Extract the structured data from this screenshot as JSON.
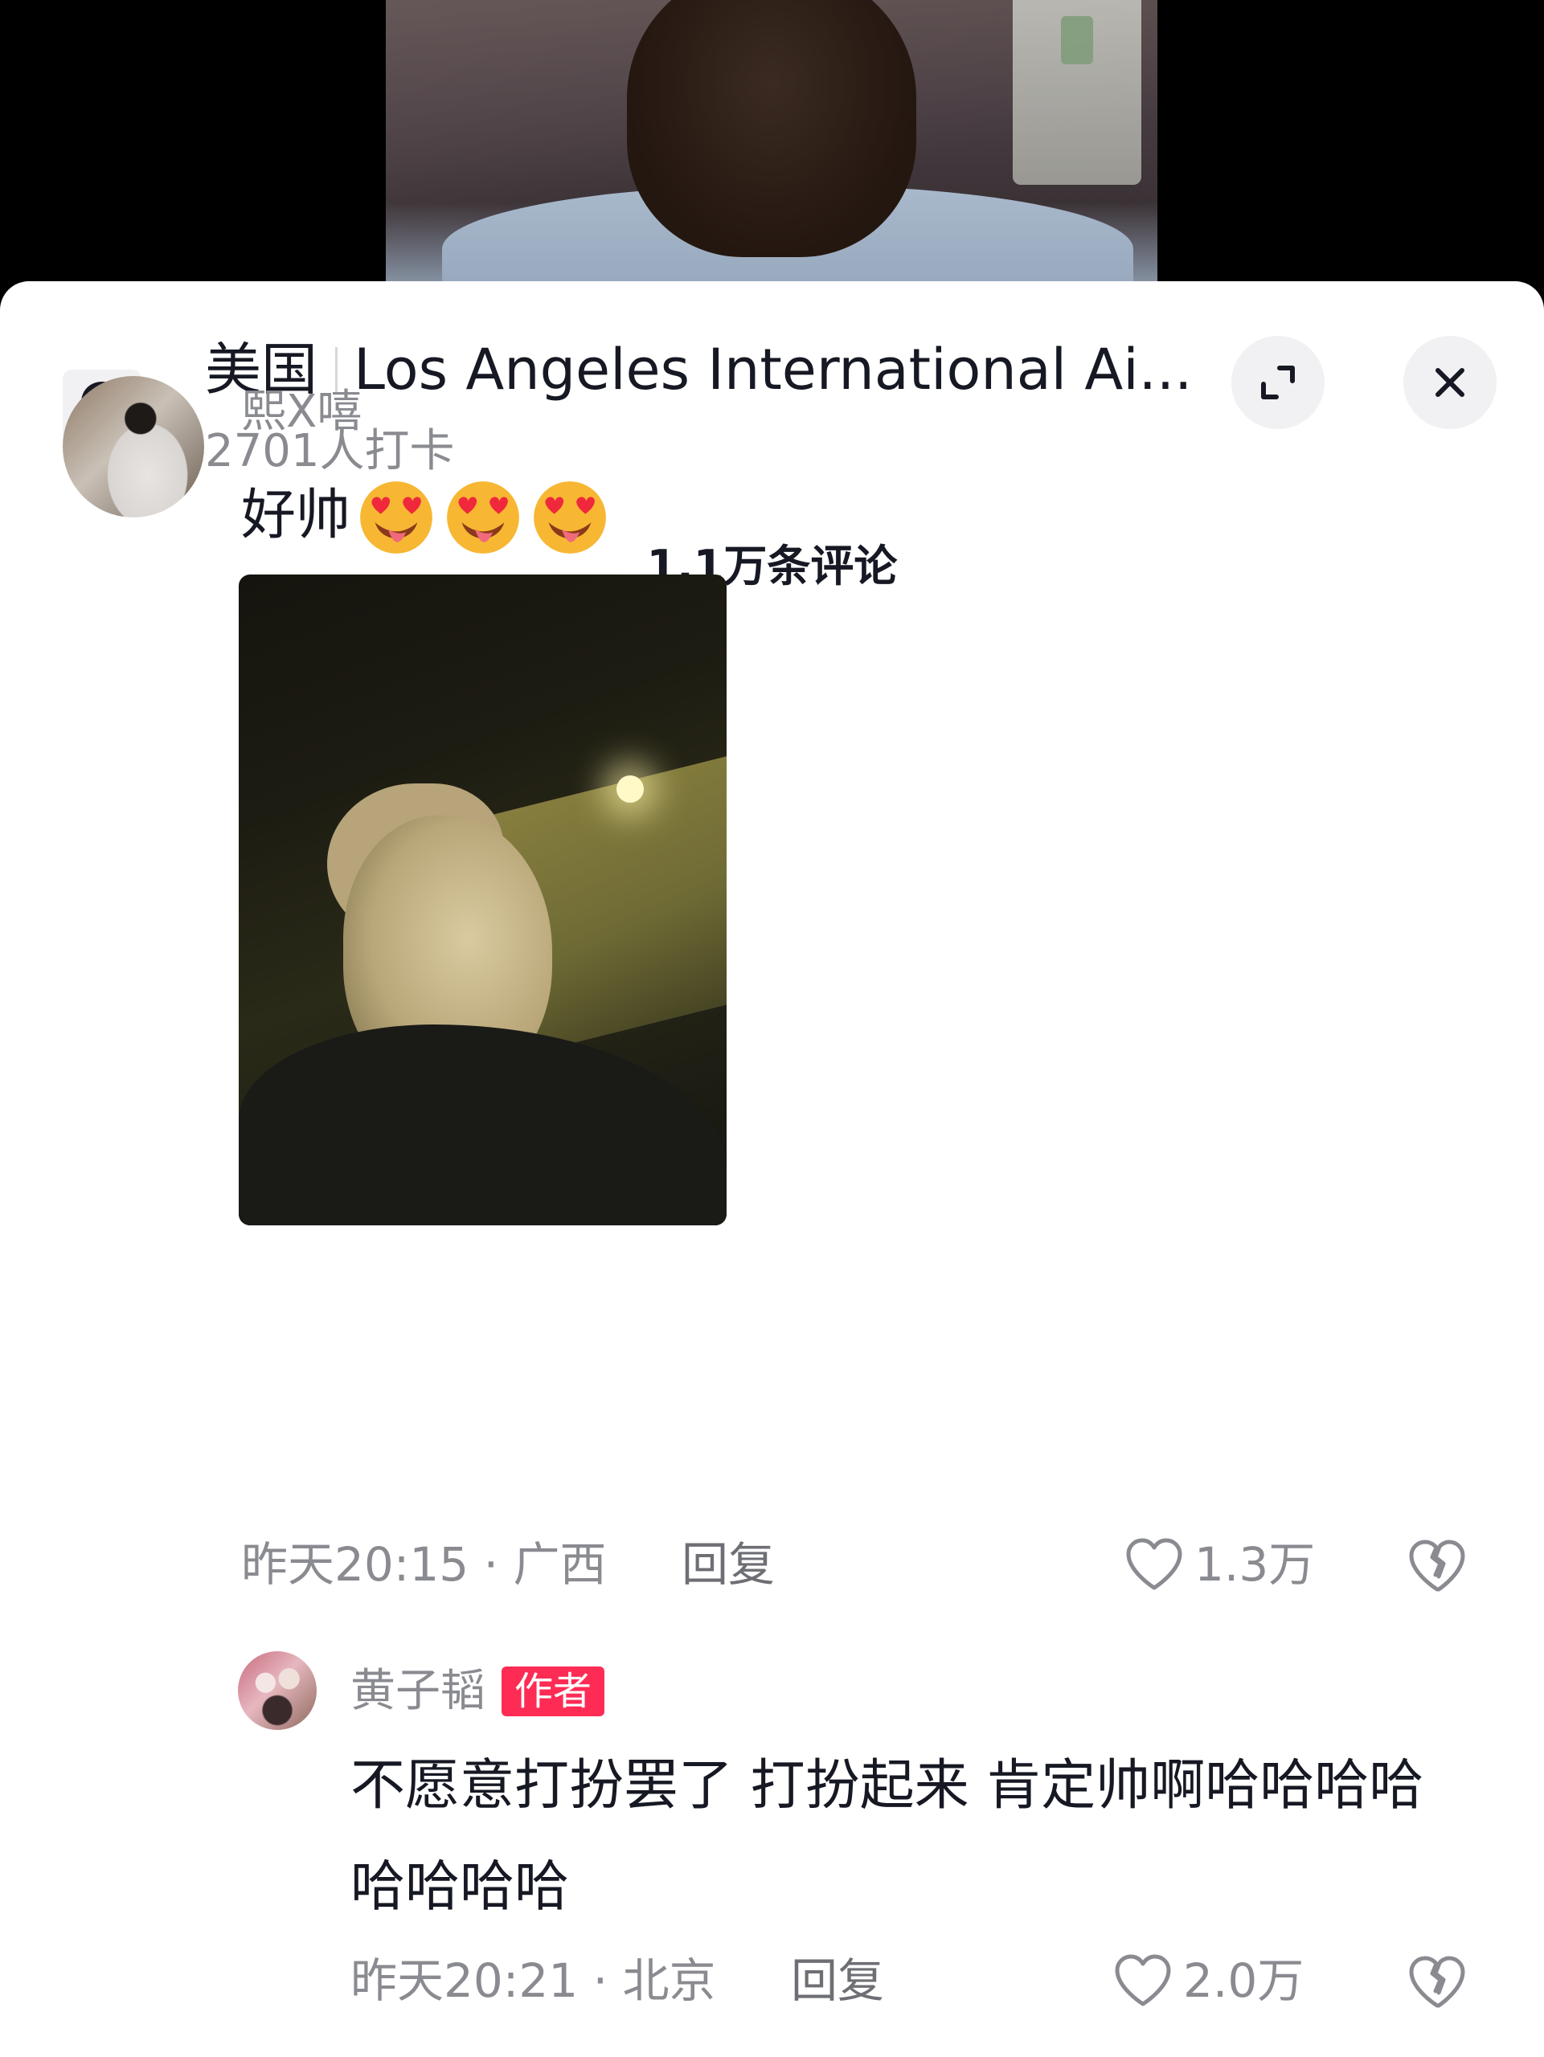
{
  "location": {
    "country": "美国",
    "place": "Los Angeles International Ai...",
    "checkins": "2701人打卡"
  },
  "header": {
    "comments_count": "1.1万条评论"
  },
  "comments": [
    {
      "username": "熙X嘻",
      "text": "好帅",
      "emoji_name": "heart-eyes-tongue-emoji",
      "emoji_count": 3,
      "time": "昨天20:15",
      "region": "广西",
      "reply_label": "回复",
      "likes": "1.3万"
    }
  ],
  "replies": [
    {
      "username": "黄子韬",
      "badge": "作者",
      "text": "不愿意打扮罢了 打扮起来 肯定帅啊哈哈哈哈哈哈哈哈",
      "time": "昨天20:21",
      "region": "北京",
      "reply_label": "回复",
      "likes": "2.0万"
    }
  ],
  "colors": {
    "accent": "#fe2c55",
    "text_primary": "#161823",
    "text_secondary": "#8a8b91",
    "sheet_bg": "#ffffff",
    "button_bg": "#f1f1f3"
  },
  "icons": {
    "location": "location-pin-icon",
    "expand": "expand-icon",
    "close": "close-icon",
    "like": "heart-outline-icon",
    "dislike": "broken-heart-icon"
  }
}
